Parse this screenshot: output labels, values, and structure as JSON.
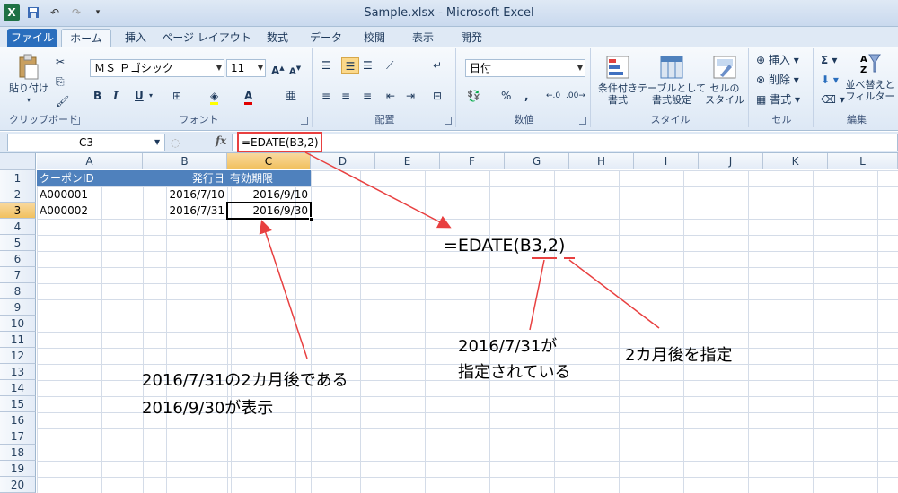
{
  "window": {
    "title": "Sample.xlsx - Microsoft Excel"
  },
  "tabs": [
    {
      "label": "ファイル"
    },
    {
      "label": "ホーム"
    },
    {
      "label": "挿入"
    },
    {
      "label": "ページ レイアウト"
    },
    {
      "label": "数式"
    },
    {
      "label": "データ"
    },
    {
      "label": "校閲"
    },
    {
      "label": "表示"
    },
    {
      "label": "開発"
    }
  ],
  "ribbon": {
    "clipboard": {
      "paste": "貼り付け",
      "label": "クリップボード"
    },
    "font": {
      "name": "ＭＳ Ｐゴシック",
      "size": "11",
      "label": "フォント"
    },
    "align": {
      "label": "配置"
    },
    "number": {
      "format": "日付",
      "label": "数値"
    },
    "style": {
      "cond": "条件付き\n書式",
      "table": "テーブルとして\n書式設定",
      "cell": "セルの\nスタイル",
      "label": "スタイル"
    },
    "cells": {
      "insert": "挿入",
      "delete": "削除",
      "format": "書式",
      "label": "セル"
    },
    "edit": {
      "sort": "並べ替えと\nフィルター",
      "label": "編集"
    }
  },
  "formula_bar": {
    "name_box": "C3",
    "fx": "fx",
    "formula": "=EDATE(B3,2)"
  },
  "grid": {
    "columns": [
      "A",
      "B",
      "C",
      "D",
      "E",
      "F",
      "G",
      "H",
      "I",
      "J",
      "K",
      "L"
    ],
    "rows": [
      "1",
      "2",
      "3",
      "4",
      "5",
      "6",
      "7",
      "8",
      "9",
      "10",
      "11",
      "12",
      "13",
      "14",
      "15",
      "16",
      "17",
      "18",
      "19",
      "20"
    ],
    "cells": {
      "A1": "クーポンID",
      "B1": "発行日",
      "C1": "有効期限",
      "A2": "A000001",
      "B2": "2016/7/10",
      "C2": "2016/9/10",
      "A3": "A000002",
      "B3": "2016/7/31",
      "C3": "2016/9/30"
    },
    "selected": "C3"
  },
  "annotations": {
    "formula_big": "=EDATE(B3,2)",
    "note_b3_1": "2016/7/31が",
    "note_b3_2": "指定されている",
    "note_months": "2カ月後を指定",
    "note_result_1": "2016/7/31の2カ月後である",
    "note_result_2": "2016/9/30が表示"
  },
  "colors": {
    "accent_file_tab": "#2a6ebd",
    "header_fill": "#4f81bd",
    "annotation_red": "#e84040"
  }
}
